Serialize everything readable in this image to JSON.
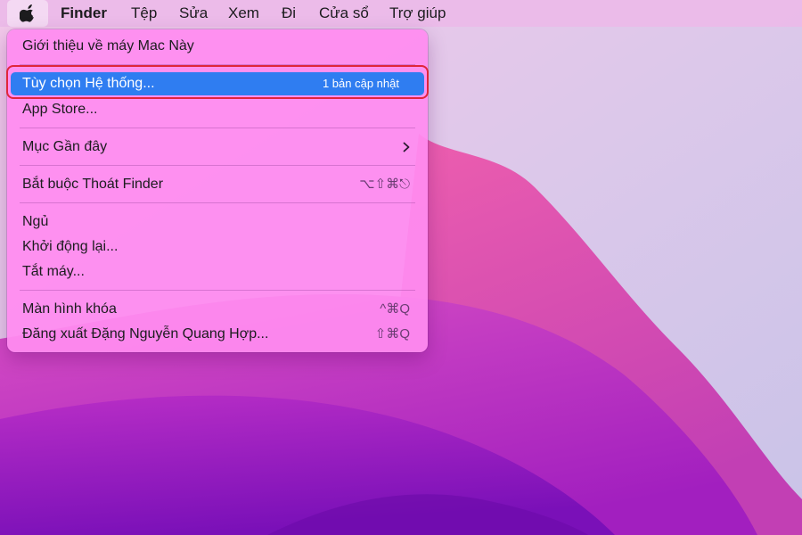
{
  "menubar": {
    "apple_icon": "apple-logo-icon",
    "app_name": "Finder",
    "items": [
      "Tệp",
      "Sửa",
      "Xem",
      "Đi",
      "Cửa sổ",
      "Trợ giúp"
    ]
  },
  "apple_menu": {
    "about": "Giới thiệu về máy Mac Này",
    "system_prefs": {
      "label": "Tùy chọn Hệ thống...",
      "badge": "1 bản cập nhật"
    },
    "app_store": "App Store...",
    "recent_items": "Mục Gần đây",
    "force_quit": {
      "label": "Bắt buộc Thoát Finder",
      "shortcut": "⌥⇧⌘⎋"
    },
    "sleep": "Ngủ",
    "restart": "Khởi động lại...",
    "shutdown": "Tắt máy...",
    "lock_screen": {
      "label": "Màn hình khóa",
      "shortcut": "^⌘Q"
    },
    "logout": {
      "label": "Đăng xuất Đặng Nguyễn Quang Hợp...",
      "shortcut": "⇧⌘Q"
    }
  },
  "colors": {
    "highlight": "#2f7df1",
    "annotation_box": "#e0263b",
    "menu_background": "#ff8cf0"
  }
}
